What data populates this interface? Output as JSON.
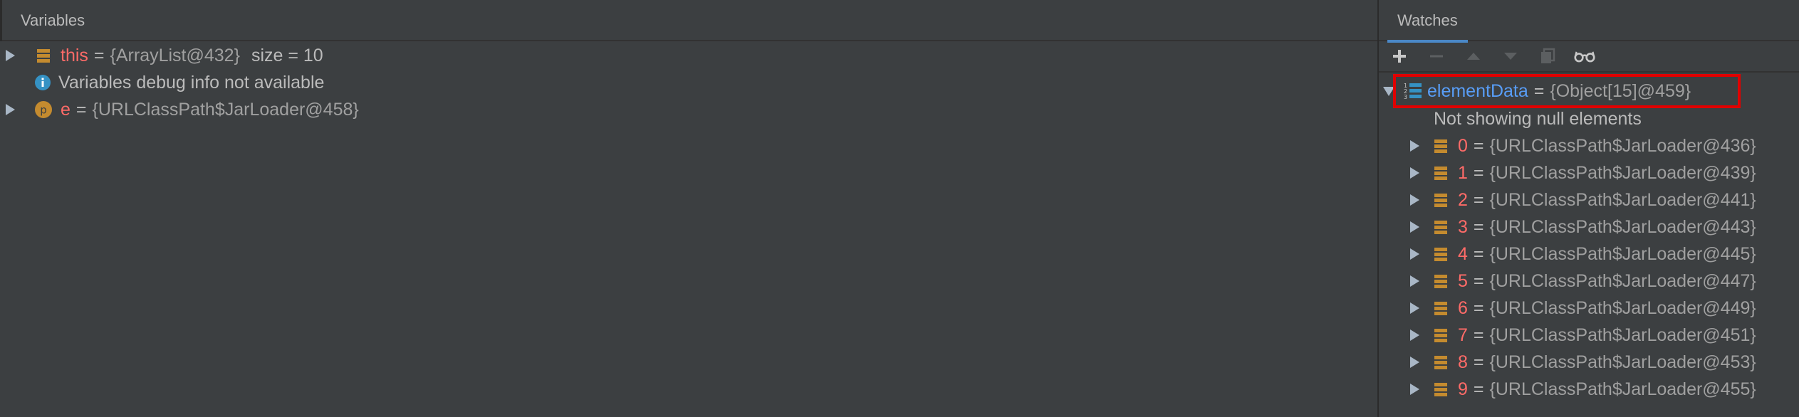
{
  "variables": {
    "tab_label": "Variables",
    "rows": [
      {
        "name": "this",
        "eq": "=",
        "value": "{ArrayList@432}",
        "extra": "size = 10"
      },
      {
        "info": "Variables debug info not available"
      },
      {
        "name": "e",
        "eq": "=",
        "value": "{URLClassPath$JarLoader@458}",
        "badge": "p"
      }
    ]
  },
  "watches": {
    "tab_label": "Watches",
    "root": {
      "name": "elementData",
      "eq": "=",
      "value": "{Object[15]@459}"
    },
    "note": "Not showing null elements",
    "items": [
      {
        "index": "0",
        "eq": "=",
        "value": "{URLClassPath$JarLoader@436}"
      },
      {
        "index": "1",
        "eq": "=",
        "value": "{URLClassPath$JarLoader@439}"
      },
      {
        "index": "2",
        "eq": "=",
        "value": "{URLClassPath$JarLoader@441}"
      },
      {
        "index": "3",
        "eq": "=",
        "value": "{URLClassPath$JarLoader@443}"
      },
      {
        "index": "4",
        "eq": "=",
        "value": "{URLClassPath$JarLoader@445}"
      },
      {
        "index": "5",
        "eq": "=",
        "value": "{URLClassPath$JarLoader@447}"
      },
      {
        "index": "6",
        "eq": "=",
        "value": "{URLClassPath$JarLoader@449}"
      },
      {
        "index": "7",
        "eq": "=",
        "value": "{URLClassPath$JarLoader@451}"
      },
      {
        "index": "8",
        "eq": "=",
        "value": "{URLClassPath$JarLoader@453}"
      },
      {
        "index": "9",
        "eq": "=",
        "value": "{URLClassPath$JarLoader@455}"
      }
    ]
  }
}
